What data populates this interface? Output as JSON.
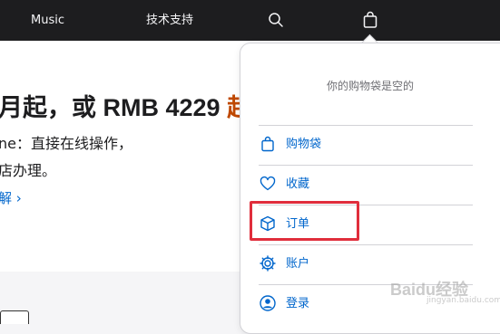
{
  "nav": {
    "music_label": "Music",
    "support_label": "技术支持",
    "search_icon": "search-icon",
    "bag_icon": "shopping-bag-icon"
  },
  "hero": {
    "line1_main": "月起，或 RMB 4229 ",
    "line1_accent": "起",
    "line2": "ne：直接在线操作，",
    "line3": "店办理。",
    "link": "解 ›"
  },
  "bag_menu": {
    "empty_message": "你的购物袋是空的",
    "items": [
      {
        "label": "购物袋",
        "icon": "bag-icon"
      },
      {
        "label": "收藏",
        "icon": "heart-icon"
      },
      {
        "label": "订单",
        "icon": "box-icon"
      },
      {
        "label": "账户",
        "icon": "gear-icon"
      },
      {
        "label": "登录",
        "icon": "person-circle-icon"
      }
    ]
  },
  "watermark": {
    "brand": "Baidu经验",
    "url": "jingyan.baidu.com"
  },
  "colors": {
    "nav_bg": "#1d1d1f",
    "link_blue": "#0066cc",
    "highlight_red": "#e02e3c",
    "price_orange": "#bf4800"
  }
}
